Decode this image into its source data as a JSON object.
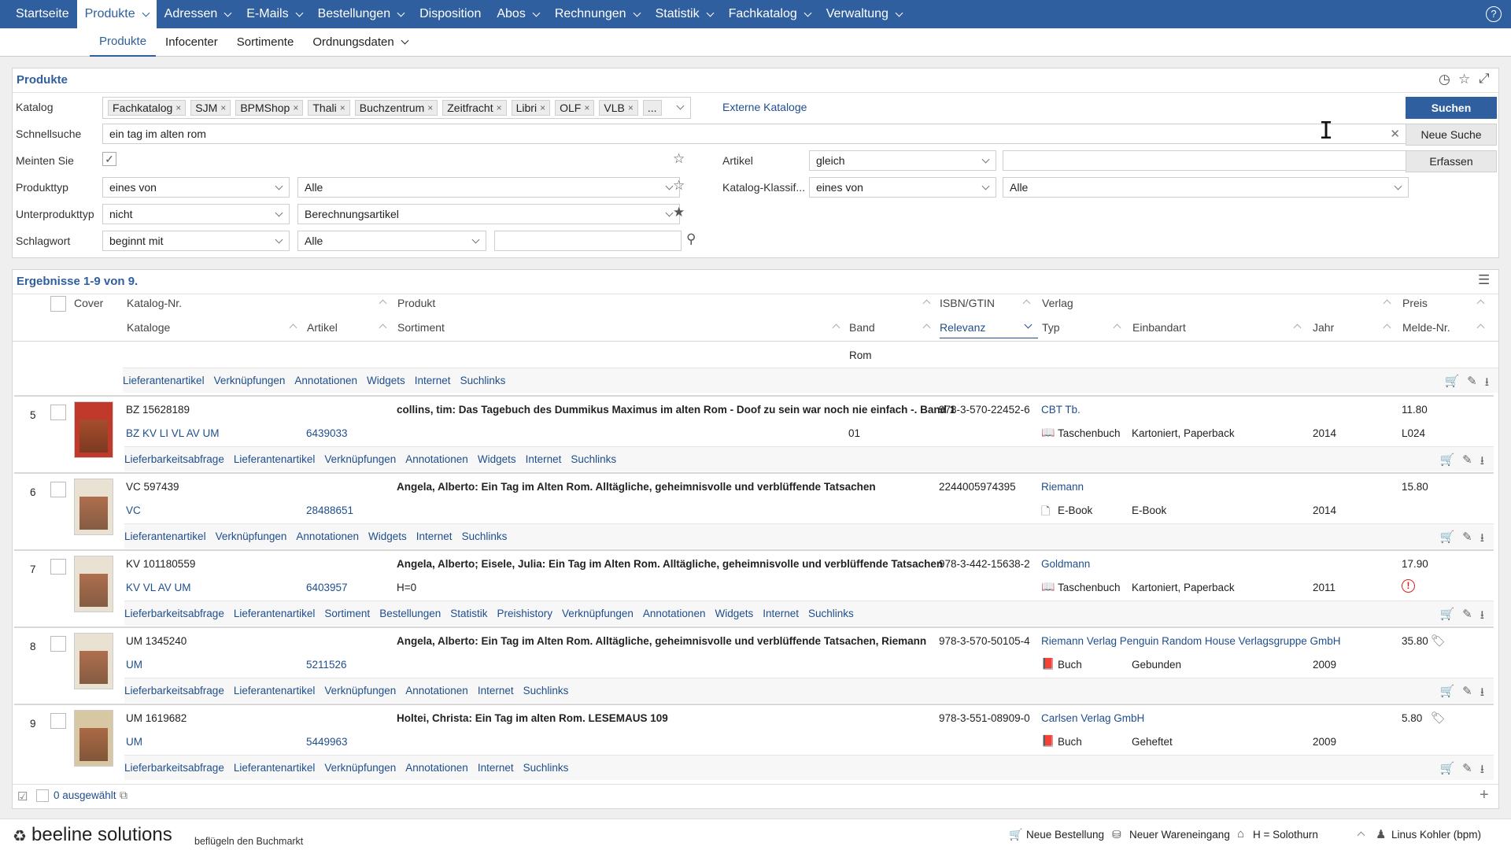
{
  "nav": {
    "items": [
      {
        "label": "Startseite",
        "caret": false,
        "active": false
      },
      {
        "label": "Produkte",
        "caret": true,
        "active": true
      },
      {
        "label": "Adressen",
        "caret": true,
        "active": false
      },
      {
        "label": "E-Mails",
        "caret": true,
        "active": false
      },
      {
        "label": "Bestellungen",
        "caret": true,
        "active": false
      },
      {
        "label": "Disposition",
        "caret": false,
        "active": false
      },
      {
        "label": "Abos",
        "caret": true,
        "active": false
      },
      {
        "label": "Rechnungen",
        "caret": true,
        "active": false
      },
      {
        "label": "Statistik",
        "caret": true,
        "active": false
      },
      {
        "label": "Fachkatalog",
        "caret": true,
        "active": false
      },
      {
        "label": "Verwaltung",
        "caret": true,
        "active": false
      }
    ],
    "help": "?"
  },
  "subnav": {
    "items": [
      {
        "label": "Produkte",
        "active": true
      },
      {
        "label": "Infocenter",
        "active": false
      },
      {
        "label": "Sortimente",
        "active": false
      },
      {
        "label": "Ordnungsdaten",
        "active": false,
        "caret": true
      }
    ]
  },
  "search": {
    "title": "Produkte",
    "labels": {
      "katalog": "Katalog",
      "schnellsuche": "Schnellsuche",
      "meinten": "Meinten Sie",
      "produkttyp": "Produkttyp",
      "unterprodukttyp": "Unterprodukttyp",
      "schlagwort": "Schlagwort",
      "artikel": "Artikel",
      "klassif": "Katalog-Klassif..."
    },
    "catalog_tags": [
      "Fachkatalog",
      "SJM",
      "BPMShop",
      "Thali",
      "Buchzentrum",
      "Zeitfracht",
      "Libri",
      "OLF",
      "VLB",
      "..."
    ],
    "externe_kataloge": "Externe Kataloge",
    "query": "ein tag im alten rom",
    "produkttyp_op": "eines von",
    "produkttyp_val": "Alle",
    "unterprodukttyp_op": "nicht",
    "unterprodukttyp_val": "Berechnungsartikel",
    "schlagwort_op": "beginnt mit",
    "schlagwort_val": "Alle",
    "schlagwort_text": "",
    "artikel_op": "gleich",
    "artikel_val": "",
    "klassif_op": "eines von",
    "klassif_val": "Alle",
    "btn_suchen": "Suchen",
    "btn_neue": "Neue Suche",
    "btn_erfassen": "Erfassen"
  },
  "results": {
    "title": "Ergebnisse 1-9 von 9.",
    "headers1": {
      "cover": "Cover",
      "katalognr": "Katalog-Nr.",
      "produkt": "Produkt",
      "isbn": "ISBN/GTIN",
      "verlag": "Verlag",
      "preis": "Preis"
    },
    "headers2": {
      "kataloge": "Kataloge",
      "artikel": "Artikel",
      "sortiment": "Sortiment",
      "band": "Band",
      "relevanz": "Relevanz",
      "typ": "Typ",
      "einbandart": "Einbandart",
      "jahr": "Jahr",
      "meldenr": "Melde-Nr."
    },
    "partial_band": "Rom",
    "partial_links": [
      "Lieferantenartikel",
      "Verknüpfungen",
      "Annotationen",
      "Widgets",
      "Internet",
      "Suchlinks"
    ],
    "rows": [
      {
        "num": "5",
        "katalognr": "BZ 15628189",
        "produkt": "collins, tim: Das Tagebuch des Dummikus Maximus im alten Rom - Doof zu sein war noch nie einfach -. Band 1",
        "isbn": "978-3-570-22452-6",
        "verlag": "CBT Tb.",
        "preis": "11.80",
        "kataloge": "BZ KV LI VL AV UM",
        "artikel": "6439033",
        "sortiment": "",
        "band": "01",
        "typ": "Taschenbuch",
        "typ_icon": "book-open-icon",
        "einbandart": "Kartoniert, Paperback",
        "jahr": "2014",
        "meldenr": "L024",
        "price_tag": false,
        "warn": false,
        "links": [
          "Lieferbarkeitsabfrage",
          "Lieferantenartikel",
          "Verknüpfungen",
          "Annotationen",
          "Widgets",
          "Internet",
          "Suchlinks"
        ],
        "cover_color": "#c0392b"
      },
      {
        "num": "6",
        "katalognr": "VC 597439",
        "produkt": "Angela, Alberto: Ein Tag im Alten Rom. Alltägliche, geheimnisvolle und verblüffende Tatsachen",
        "isbn": "2244005974395",
        "verlag": "Riemann",
        "preis": "15.80",
        "kataloge": "VC",
        "artikel": "28488651",
        "sortiment": "",
        "band": "",
        "typ": "E-Book",
        "typ_icon": "ebook-icon",
        "einbandart": "E-Book",
        "jahr": "2014",
        "meldenr": "",
        "price_tag": false,
        "warn": false,
        "links": [
          "Lieferantenartikel",
          "Verknüpfungen",
          "Annotationen",
          "Widgets",
          "Internet",
          "Suchlinks"
        ],
        "cover_color": "#e9e1d2"
      },
      {
        "num": "7",
        "katalognr": "KV 101180559",
        "produkt": "Angela, Alberto; Eisele, Julia: Ein Tag im Alten Rom. Alltägliche, geheimnisvolle und verblüffende Tatsachen",
        "isbn": "978-3-442-15638-2",
        "verlag": "Goldmann",
        "preis": "17.90",
        "kataloge": "KV VL AV UM",
        "artikel": "6403957",
        "sortiment": "H=0",
        "band": "",
        "typ": "Taschenbuch",
        "typ_icon": "book-open-icon",
        "einbandart": "Kartoniert, Paperback",
        "jahr": "2011",
        "meldenr": "",
        "price_tag": false,
        "warn": true,
        "links": [
          "Lieferbarkeitsabfrage",
          "Lieferantenartikel",
          "Sortiment",
          "Bestellungen",
          "Statistik",
          "Preishistory",
          "Verknüpfungen",
          "Annotationen",
          "Widgets",
          "Internet",
          "Suchlinks"
        ],
        "cover_color": "#e9e1d2"
      },
      {
        "num": "8",
        "katalognr": "UM 1345240",
        "produkt": "Angela, Alberto: Ein Tag im Alten Rom. Alltägliche, geheimnisvolle und verblüffende Tatsachen, Riemann",
        "isbn": "978-3-570-50105-4",
        "verlag": "Riemann Verlag Penguin Random House Verlagsgruppe GmbH",
        "preis": "35.80",
        "kataloge": "UM",
        "artikel": "5211526",
        "sortiment": "",
        "band": "",
        "typ": "Buch",
        "typ_icon": "book-icon",
        "einbandart": "Gebunden",
        "jahr": "2009",
        "meldenr": "",
        "price_tag": true,
        "warn": false,
        "links": [
          "Lieferbarkeitsabfrage",
          "Lieferantenartikel",
          "Verknüpfungen",
          "Annotationen",
          "Internet",
          "Suchlinks"
        ],
        "cover_color": "#e9e1d2"
      },
      {
        "num": "9",
        "katalognr": "UM 1619682",
        "produkt": "Holtei, Christa: Ein Tag im alten Rom. LESEMAUS 109",
        "isbn": "978-3-551-08909-0",
        "verlag": "Carlsen Verlag GmbH",
        "preis": "5.80",
        "kataloge": "UM",
        "artikel": "5449963",
        "sortiment": "",
        "band": "",
        "typ": "Buch",
        "typ_icon": "book-icon",
        "einbandart": "Geheftet",
        "jahr": "2009",
        "meldenr": "",
        "price_tag": true,
        "warn": false,
        "links": [
          "Lieferbarkeitsabfrage",
          "Lieferantenartikel",
          "Verknüpfungen",
          "Annotationen",
          "Internet",
          "Suchlinks"
        ],
        "cover_color": "#d8c7a3"
      }
    ],
    "selected": "0 ausgewählt"
  },
  "footer": {
    "brand": "beeline",
    "brand2": "solutions",
    "tagline": "beflügeln den Buchmarkt",
    "neue_bestellung": "Neue Bestellung",
    "wareneingang": "Neuer Wareneingang",
    "filiale": "H = Solothurn",
    "user": "Linus Kohler (bpm)"
  },
  "colors": {
    "accent": "#2f5f9e",
    "link": "#1f4e8c",
    "warn": "#d62020"
  }
}
